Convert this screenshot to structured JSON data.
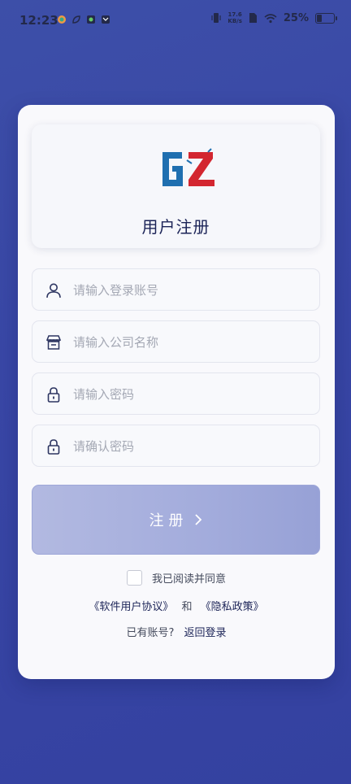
{
  "status_bar": {
    "time": "12:23",
    "net_speed_value": "17.6",
    "net_speed_unit": "KB/s",
    "battery_percent": "25%",
    "battery_level": 0.25
  },
  "brand": {
    "logo_text": "GZ",
    "title": "用户注册"
  },
  "form": {
    "account_placeholder": "请输入登录账号",
    "company_placeholder": "请输入公司名称",
    "password_placeholder": "请输入密码",
    "confirm_placeholder": "请确认密码",
    "account_value": "",
    "company_value": "",
    "password_value": "",
    "confirm_value": ""
  },
  "actions": {
    "register_label": "注册"
  },
  "agreement": {
    "agree_label": "我已阅读并同意",
    "user_agreement": "《软件用户协议》",
    "and_text": "和",
    "privacy_policy": "《隐私政策》",
    "checked": false
  },
  "login": {
    "prompt": "已有账号?",
    "link": "返回登录"
  },
  "colors": {
    "background": "#3947a6",
    "title": "#1b2357",
    "button": "#a3acdc",
    "logo_blue": "#1f6fb0",
    "logo_red": "#d32630"
  }
}
